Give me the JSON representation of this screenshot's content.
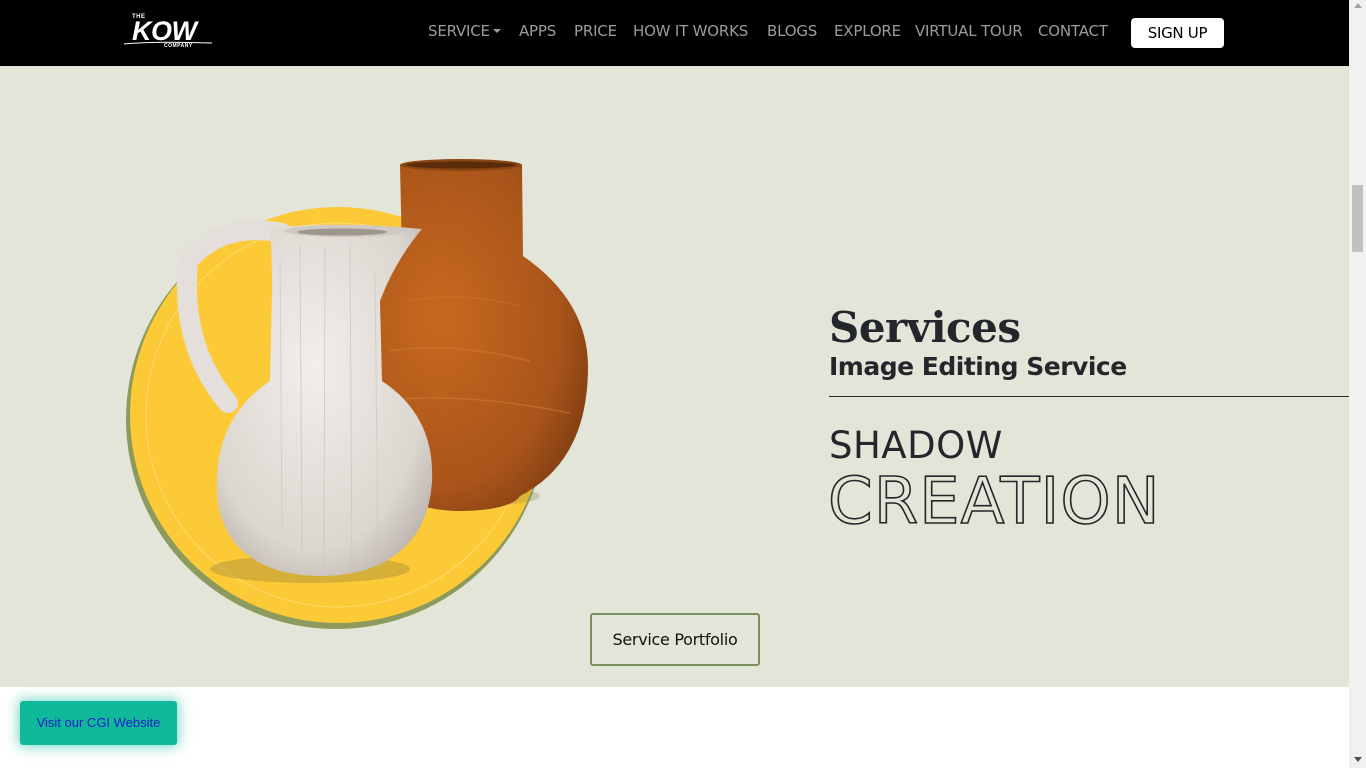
{
  "header": {
    "logo": {
      "top": "THE",
      "main": "KOW",
      "bottom": "COMPANY"
    },
    "nav": [
      {
        "label": "SERVICE",
        "dropdown": true
      },
      {
        "label": "APPS"
      },
      {
        "label": "PRICE"
      },
      {
        "label": "HOW IT WORKS"
      },
      {
        "label": "BLOGS"
      },
      {
        "label": "EXPLORE"
      },
      {
        "label": "VIRTUAL TOUR"
      },
      {
        "label": "CONTACT"
      }
    ],
    "signup_label": "SIGN UP"
  },
  "hero": {
    "heading": "Services",
    "subheading": "Image Editing Service",
    "title_line1": "SHADOW",
    "title_line2": "CREATION",
    "button_label": "Service Portfolio"
  },
  "floating": {
    "cgi_label": "Visit our CGI Website"
  },
  "colors": {
    "navbar_bg": "#000000",
    "hero_bg": "#e3e5d8",
    "circle_yellow": "#fcca36",
    "circle_shadow": "#8c9a5d",
    "vase_brown": "#b05a1c",
    "jug_white": "#e6e1dc",
    "cgi_button": "#10b99a",
    "cgi_text": "#1a1dc8"
  },
  "icons": {
    "service_dropdown": "chevron-down-icon",
    "scroll_up": "triangle-up-icon",
    "scroll_down": "triangle-down-icon"
  }
}
